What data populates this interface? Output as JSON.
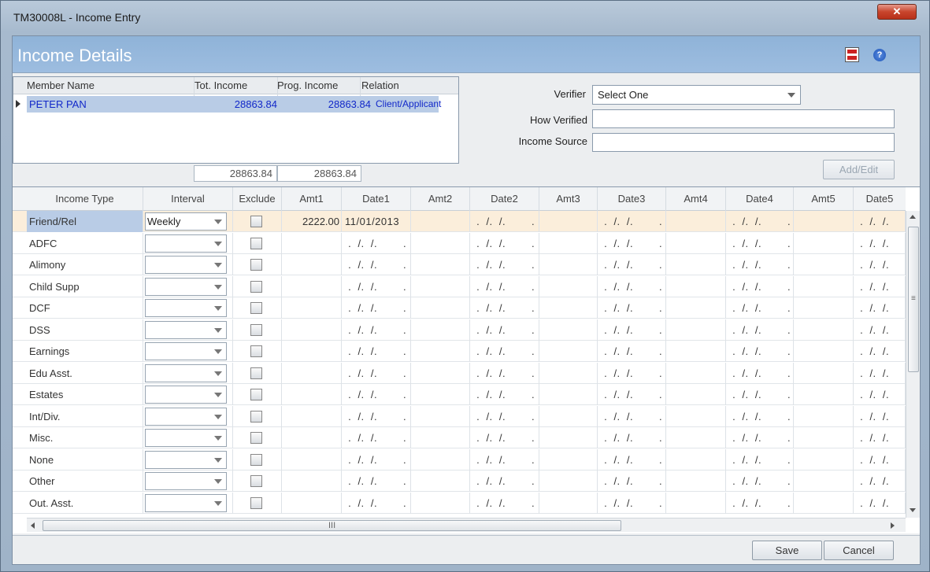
{
  "window": {
    "title": "TM30008L - Income Entry",
    "close_label": "✕"
  },
  "header": {
    "title": "Income Details",
    "pdf_icon": "pdf-icon",
    "help_icon": "help-icon",
    "help_glyph": "?"
  },
  "members": {
    "columns": [
      "Member Name",
      "Tot. Income",
      "Prog. Income",
      "Relation"
    ],
    "rows": [
      {
        "name": "PETER PAN",
        "tot_income": "28863.84",
        "prog_income": "28863.84",
        "relation": "Client/Applicant"
      }
    ],
    "totals": {
      "tot_income": "28863.84",
      "prog_income": "28863.84"
    }
  },
  "form": {
    "verifier_label": "Verifier",
    "verifier_value": "Select One",
    "how_verified_label": "How Verified",
    "how_verified_value": "",
    "income_source_label": "Income Source",
    "income_source_value": "",
    "add_edit_label": "Add/Edit"
  },
  "income": {
    "columns": [
      "Income Type",
      "Interval",
      "Exclude",
      "Amt1",
      "Date1",
      "Amt2",
      "Date2",
      "Amt3",
      "Date3",
      "Amt4",
      "Date4",
      "Amt5",
      "Date5"
    ],
    "empty_date": " .  /.  /.        .",
    "rows": [
      {
        "type": "Friend/Rel",
        "interval": "Weekly",
        "amt1": "2222.00",
        "date1": "11/01/2013"
      },
      {
        "type": "ADFC",
        "interval": "",
        "amt1": "",
        "date1": ""
      },
      {
        "type": "Alimony",
        "interval": "",
        "amt1": "",
        "date1": ""
      },
      {
        "type": "Child Supp",
        "interval": "",
        "amt1": "",
        "date1": ""
      },
      {
        "type": "DCF",
        "interval": "",
        "amt1": "",
        "date1": ""
      },
      {
        "type": "DSS",
        "interval": "",
        "amt1": "",
        "date1": ""
      },
      {
        "type": "Earnings",
        "interval": "",
        "amt1": "",
        "date1": ""
      },
      {
        "type": "Edu Asst.",
        "interval": "",
        "amt1": "",
        "date1": ""
      },
      {
        "type": "Estates",
        "interval": "",
        "amt1": "",
        "date1": ""
      },
      {
        "type": "Int/Div.",
        "interval": "",
        "amt1": "",
        "date1": ""
      },
      {
        "type": "Misc.",
        "interval": "",
        "amt1": "",
        "date1": ""
      },
      {
        "type": "None",
        "interval": "",
        "amt1": "",
        "date1": ""
      },
      {
        "type": "Other",
        "interval": "",
        "amt1": "",
        "date1": ""
      },
      {
        "type": "Out. Asst.",
        "interval": "",
        "amt1": "",
        "date1": ""
      }
    ]
  },
  "footer": {
    "save_label": "Save",
    "cancel_label": "Cancel"
  },
  "colors": {
    "header_band": "#9dbde0",
    "selection": "#b9cce6",
    "active_row": "#fbeedb",
    "link_text": "#1228c9"
  }
}
